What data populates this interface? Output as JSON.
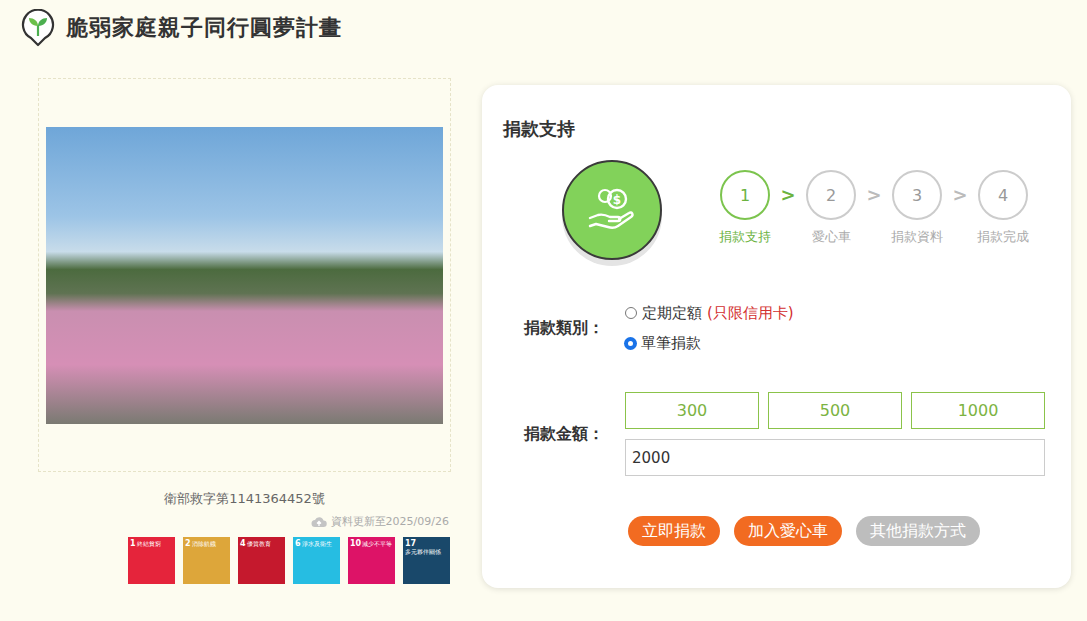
{
  "header": {
    "title": "脆弱家庭親子同行圓夢計畫"
  },
  "license": "衛部救字第1141364452號",
  "updated": "資料更新至2025/09/26",
  "sdgs": [
    {
      "number": "1",
      "label": "終結貧窮",
      "color": "#e5243b"
    },
    {
      "number": "2",
      "label": "消除飢餓",
      "color": "#dda63a"
    },
    {
      "number": "4",
      "label": "優質教育",
      "color": "#c5192d"
    },
    {
      "number": "6",
      "label": "淨水及衛生",
      "color": "#26bde2"
    },
    {
      "number": "10",
      "label": "減少不平等",
      "color": "#dd1367"
    },
    {
      "number": "17",
      "label": "多元夥伴關係",
      "color": "#19486a"
    }
  ],
  "donation": {
    "title": "捐款支持",
    "steps": [
      {
        "number": "1",
        "label": "捐款支持",
        "selected": true
      },
      {
        "number": "2",
        "label": "愛心車",
        "selected": false
      },
      {
        "number": "3",
        "label": "捐款資料",
        "selected": false
      },
      {
        "number": "4",
        "label": "捐款完成",
        "selected": false
      }
    ],
    "separators": [
      {
        "text": ">",
        "active": true
      },
      {
        "text": ">",
        "active": false
      },
      {
        "text": ">",
        "active": false
      }
    ],
    "type_label": "捐款類別：",
    "types": [
      {
        "label": "定期定額",
        "note": "(只限信用卡)",
        "selected": false
      },
      {
        "label": "單筆捐款",
        "selected": true
      }
    ],
    "amount_label": "捐款金額：",
    "amounts": [
      {
        "value": "300",
        "selected": false
      },
      {
        "value": "500",
        "selected": false
      },
      {
        "value": "1000",
        "selected": false
      }
    ],
    "amount_input": {
      "value": "2000"
    },
    "buttons": [
      {
        "label": "立即捐款",
        "kind": "primary"
      },
      {
        "label": "加入愛心車",
        "kind": "primary"
      },
      {
        "label": "其他捐款方式",
        "kind": "secondary"
      }
    ]
  }
}
